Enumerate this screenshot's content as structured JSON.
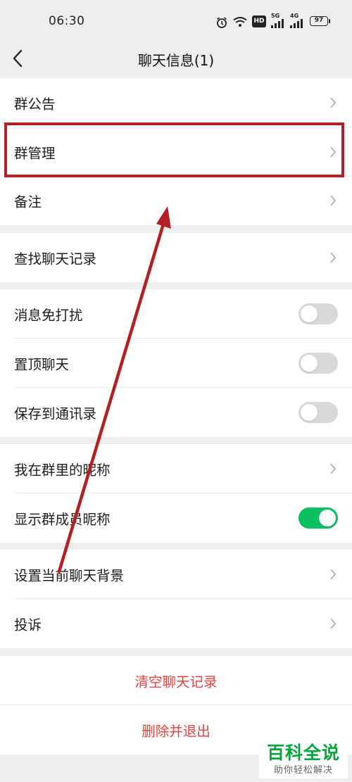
{
  "status_bar": {
    "time": "06:30",
    "battery": "97",
    "network_5g": "5G",
    "network_4g": "4G",
    "hd_badge": "HD"
  },
  "header": {
    "title": "聊天信息(1)"
  },
  "group1": [
    {
      "label": "群公告"
    },
    {
      "label": "群管理"
    },
    {
      "label": "备注"
    }
  ],
  "group2": [
    {
      "label": "查找聊天记录"
    }
  ],
  "group3": [
    {
      "label": "消息免打扰",
      "toggle": false
    },
    {
      "label": "置顶聊天",
      "toggle": false
    },
    {
      "label": "保存到通讯录",
      "toggle": false
    }
  ],
  "group4": [
    {
      "label": "我在群里的昵称"
    },
    {
      "label": "显示群成员昵称",
      "toggle": true
    }
  ],
  "group5": [
    {
      "label": "设置当前聊天背景"
    },
    {
      "label": "投诉"
    }
  ],
  "actions": {
    "clear_history": "清空聊天记录",
    "delete_and_exit": "删除并退出"
  },
  "colors": {
    "accent_green": "#07c160",
    "danger_red": "#e64340",
    "annotation_red": "#b41f24"
  },
  "watermark": {
    "title": "百科全说",
    "subtitle": "助你轻松解决"
  }
}
